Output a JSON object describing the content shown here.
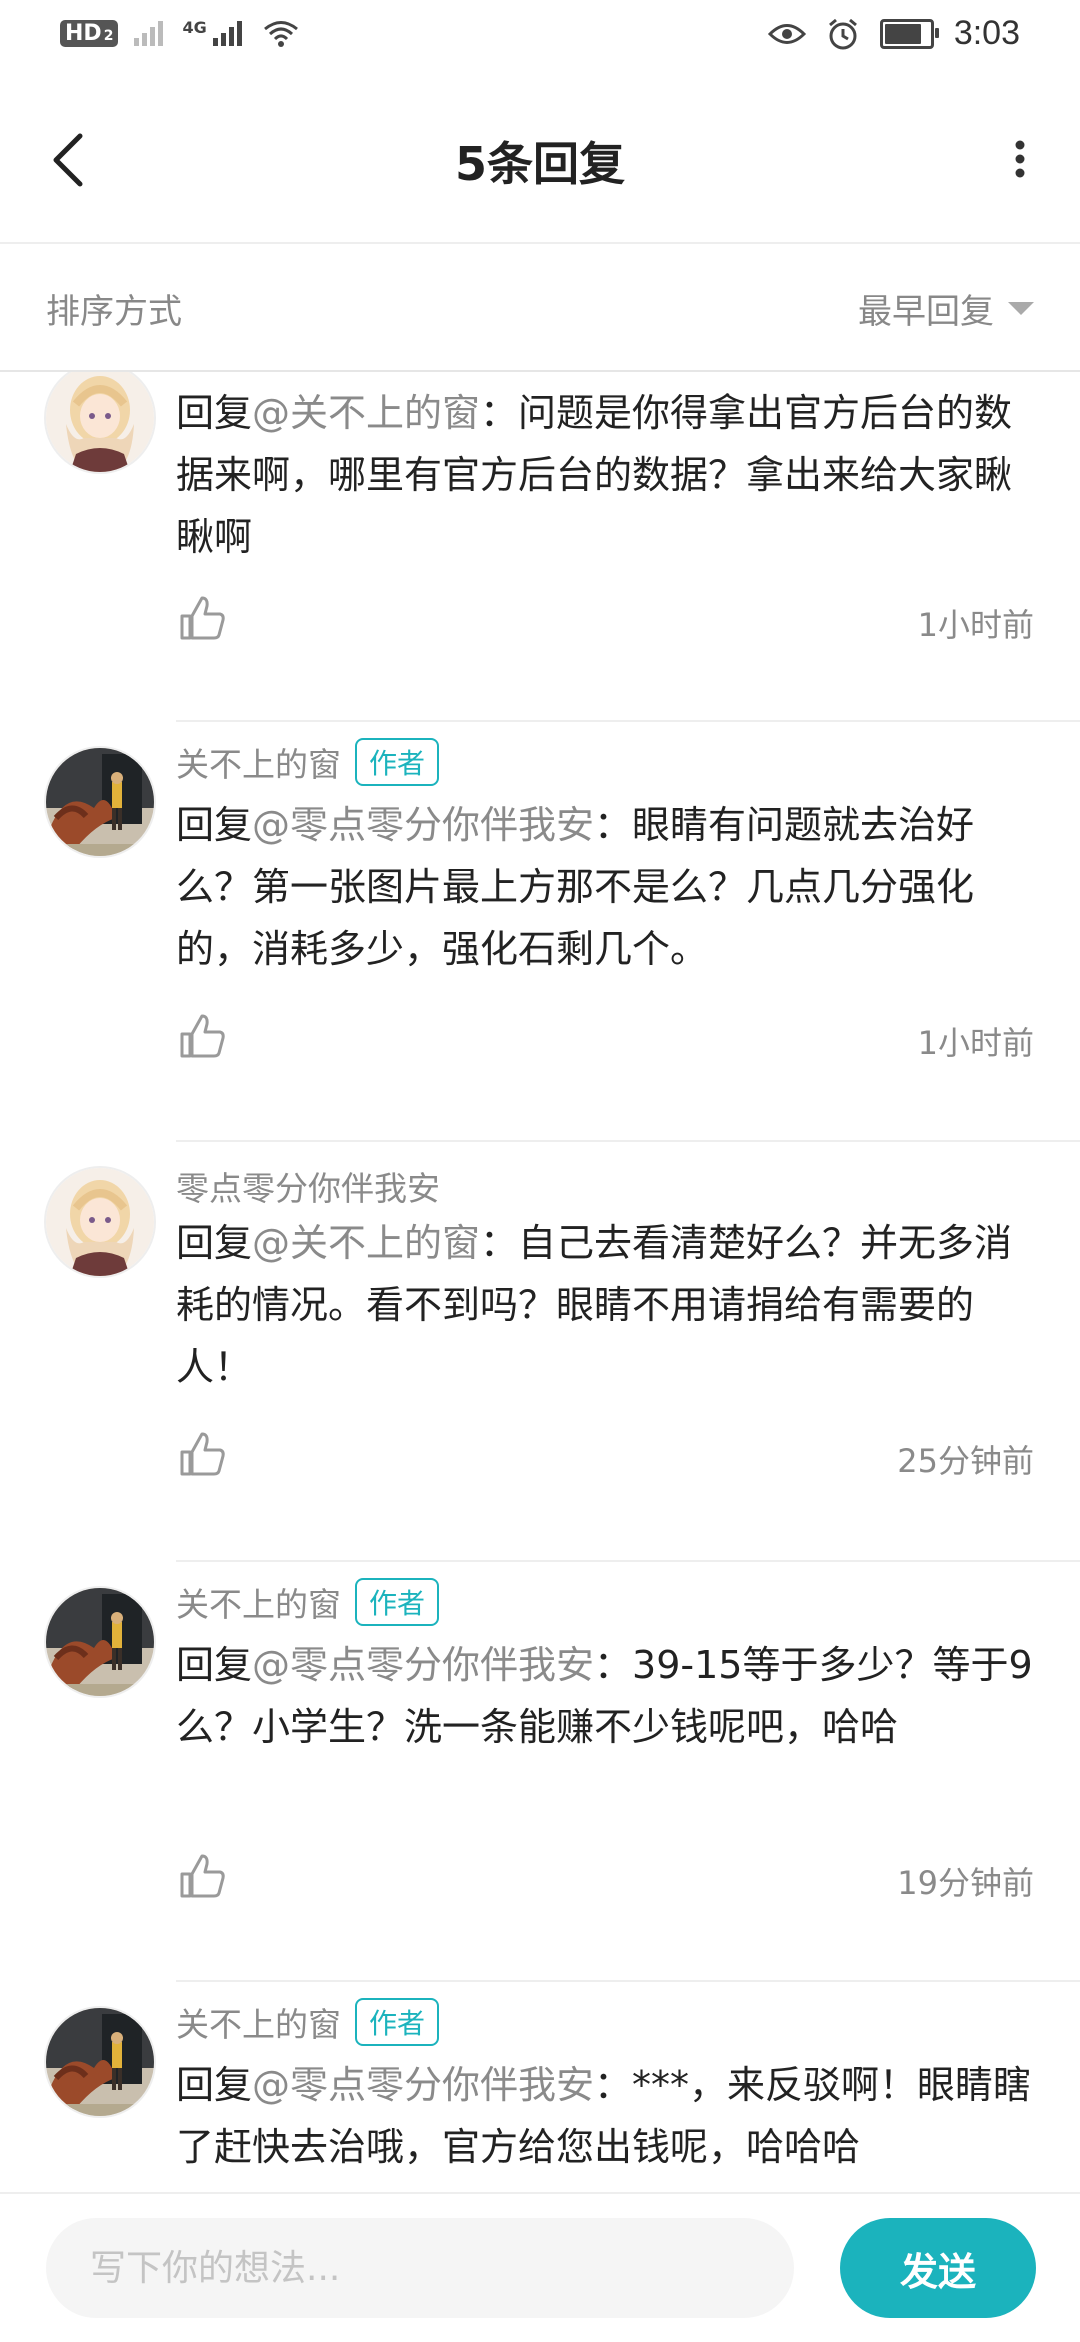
{
  "status_bar": {
    "hd_label": "HD",
    "hd_sub": "2",
    "network_label": "4G",
    "time": "3:03",
    "battery_level": 0.9,
    "icons": [
      "hd-icon",
      "signal-icon",
      "wifi-icon",
      "eye-icon",
      "alarm-icon",
      "battery-icon"
    ]
  },
  "header": {
    "title": "5条回复",
    "back_icon": "chevron-left-icon",
    "more_icon": "more-vertical-icon"
  },
  "sort": {
    "label": "排序方式",
    "selected": "最早回复"
  },
  "comments": [
    {
      "author": "",
      "is_author": false,
      "avatar": "anime-girl",
      "reply_prefix": "回复",
      "mention": "@关不上的窗",
      "text": "：问题是你得拿出官方后台的数据来啊，哪里有官方后台的数据？拿出来给大家瞅瞅啊",
      "time": "1小时前"
    },
    {
      "author": "关不上的窗",
      "is_author": true,
      "badge": "作者",
      "avatar": "game-character",
      "reply_prefix": "回复",
      "mention": "@零点零分你伴我安",
      "text": "：眼睛有问题就去治好么？第一张图片最上方那不是么？几点几分强化的，消耗多少，强化石剩几个。",
      "time": "1小时前"
    },
    {
      "author": "零点零分你伴我安",
      "is_author": false,
      "avatar": "anime-girl",
      "reply_prefix": "回复",
      "mention": "@关不上的窗",
      "text": "：自己去看清楚好么？并无多消耗的情况。看不到吗？眼睛不用请捐给有需要的人！",
      "time": "25分钟前"
    },
    {
      "author": "关不上的窗",
      "is_author": true,
      "badge": "作者",
      "avatar": "game-character",
      "reply_prefix": "回复",
      "mention": "@零点零分你伴我安",
      "text": "：39-15等于多少？等于9么？小学生？洗一条能赚不少钱呢吧，哈哈",
      "time": "19分钟前"
    },
    {
      "author": "关不上的窗",
      "is_author": true,
      "badge": "作者",
      "avatar": "game-character",
      "reply_prefix": "回复",
      "mention": "@零点零分你伴我安",
      "text": "：***，来反驳啊！眼睛瞎了赶快去治哦，官方给您出钱呢，哈哈哈",
      "time": ""
    }
  ],
  "composer": {
    "placeholder": "写下你的想法...",
    "send_label": "发送"
  },
  "colors": {
    "accent": "#1bb3bd",
    "muted_text": "#8a8a8a",
    "body_text": "#222222"
  }
}
